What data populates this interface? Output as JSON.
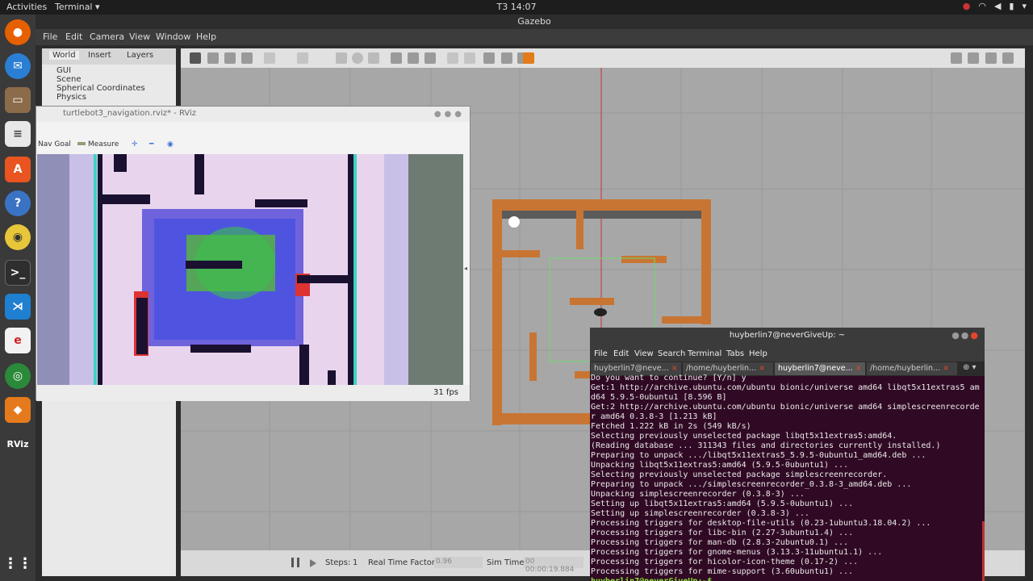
{
  "topbar": {
    "activities": "Activities",
    "app_menu": "Terminal ▾",
    "clock": "T3 14:07"
  },
  "gazebo": {
    "window_title": "Gazebo",
    "menu": [
      "File",
      "Edit",
      "Camera",
      "View",
      "Window",
      "Help"
    ],
    "left_tabs": [
      "World",
      "Insert",
      "Layers"
    ],
    "tree": [
      "GUI",
      "Scene",
      "Spherical Coordinates",
      "Physics"
    ],
    "bottom": {
      "steps_label": "Steps:",
      "steps_value": "1",
      "rtf_label": "Real Time Factor:",
      "rtf_value": "0.96",
      "simtime_label": "Sim Time:",
      "simtime_value": "00 00:00:19.884"
    }
  },
  "rviz": {
    "title": "turtlebot3_navigation.rviz* - RViz",
    "tools": {
      "nav_goal": "Nav Goal",
      "measure": "Measure"
    },
    "fps": "31 fps"
  },
  "terminal": {
    "title": "huyberlin7@neverGiveUp: ~",
    "menu": [
      "File",
      "Edit",
      "View",
      "Search",
      "Terminal",
      "Tabs",
      "Help"
    ],
    "tabs": [
      "huyberlin7@neve...",
      "/home/huyberlin...",
      "huyberlin7@neve...",
      "/home/huyberlin..."
    ],
    "lines": [
      "Do you want to continue? [Y/n] y",
      "Get:1 http://archive.ubuntu.com/ubuntu bionic/universe amd64 libqt5x11extras5 am",
      "d64 5.9.5-0ubuntu1 [8.596 B]",
      "Get:2 http://archive.ubuntu.com/ubuntu bionic/universe amd64 simplescreenrecorde",
      "r amd64 0.3.8-3 [1.213 kB]",
      "Fetched 1.222 kB in 2s (549 kB/s)",
      "Selecting previously unselected package libqt5x11extras5:amd64.",
      "(Reading database ... 311343 files and directories currently installed.)",
      "Preparing to unpack .../libqt5x11extras5_5.9.5-0ubuntu1_amd64.deb ...",
      "Unpacking libqt5x11extras5:amd64 (5.9.5-0ubuntu1) ...",
      "Selecting previously unselected package simplescreenrecorder.",
      "Preparing to unpack .../simplescreenrecorder_0.3.8-3_amd64.deb ...",
      "Unpacking simplescreenrecorder (0.3.8-3) ...",
      "Setting up libqt5x11extras5:amd64 (5.9.5-0ubuntu1) ...",
      "Setting up simplescreenrecorder (0.3.8-3) ...",
      "Processing triggers for desktop-file-utils (0.23-1ubuntu3.18.04.2) ...",
      "Processing triggers for libc-bin (2.27-3ubuntu1.4) ...",
      "Processing triggers for man-db (2.8.3-2ubuntu0.1) ...",
      "Processing triggers for gnome-menus (3.13.3-11ubuntu1.1) ...",
      "Processing triggers for hicolor-icon-theme (0.17-2) ...",
      "Processing triggers for mime-support (3.60ubuntu1) ..."
    ],
    "prompt": "huyberlin7@neverGiveUp:~$ "
  },
  "dock_icons": [
    "firefox-icon",
    "thunderbird-icon",
    "files-icon",
    "text-editor-icon",
    "software-center-icon",
    "help-icon",
    "rhythmbox-icon",
    "terminal-icon",
    "vscode-icon",
    "zotero-icon",
    "chrome-icon",
    "layers-icon",
    "rviz-icon",
    "apps-grid-icon"
  ],
  "colors": {
    "terminal_bg": "#300a24",
    "prompt_green": "#8ae234"
  }
}
